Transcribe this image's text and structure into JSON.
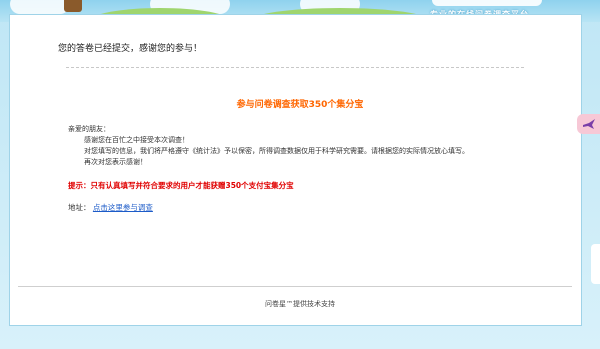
{
  "header": {
    "tagline": "专业的在线问卷调查平台"
  },
  "message": {
    "thanks": "您的答卷已经提交，感谢您的参与！"
  },
  "promo": {
    "headline": "参与问卷调查获取350个集分宝",
    "greeting": "亲爱的朋友：",
    "line1": "感谢您在百忙之中接受本次调查！",
    "line2": "对您填写的信息，我们将严格遵守《统计法》予以保密，所得调查数据仅用于科学研究需要。请根据您的实际情况放心填写。",
    "line3": "再次对您表示感谢！",
    "tip": "提示：只有认真填写并符合要求的用户才能获赠350个支付宝集分宝",
    "address_label": "地址：",
    "address_link": "点击这里参与调查"
  },
  "footer": {
    "text": "问卷星™提供技术支持"
  },
  "side_tab": {
    "icon": "bird-icon",
    "color": "#f7c8d6"
  },
  "colors": {
    "accent_orange": "#ff6600",
    "tip_red": "#e00000",
    "link_blue": "#1c5bc8"
  }
}
